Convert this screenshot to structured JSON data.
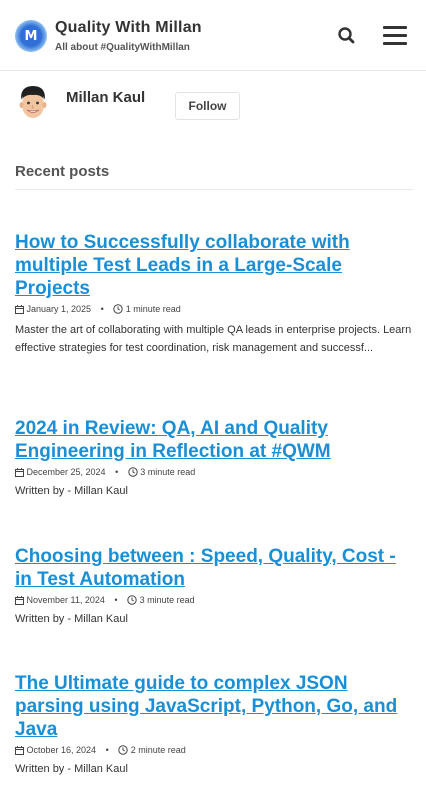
{
  "header": {
    "logo_letter": "M",
    "title": "Quality With Millan",
    "subtitle": "All about #QualityWithMillan"
  },
  "author": {
    "name": "Millan Kaul",
    "follow_label": "Follow"
  },
  "section": {
    "title": "Recent posts"
  },
  "posts": [
    {
      "title": "How to Successfully collaborate with multiple Test Leads in a Large-Scale Projects",
      "date": "January 1, 2025",
      "read_time": "1 minute read",
      "excerpt": "Master the art of collaborating with multiple QA leads in enterprise projects. Learn effective strategies for test coordination, risk management and successf..."
    },
    {
      "title": "2024 in Review: QA, AI and Quality Engineering in Reflection at #QWM",
      "date": "December 25, 2024",
      "read_time": "3 minute read",
      "byline": "Written by - Millan Kaul"
    },
    {
      "title": "Choosing between : Speed, Quality, Cost - in Test Automation",
      "date": "November 11, 2024",
      "read_time": "3 minute read",
      "byline": "Written by - Millan Kaul"
    },
    {
      "title": "The Ultimate guide to complex JSON parsing using JavaScript, Python, Go, and Java",
      "date": "October 16, 2024",
      "read_time": "2 minute read",
      "byline": "Written by - Millan Kaul"
    }
  ],
  "meta_separator": "•",
  "colors": {
    "link": "#1a8fd6",
    "text": "#333333"
  },
  "icons": {
    "search": "search-icon",
    "menu": "hamburger-menu-icon",
    "calendar": "calendar-icon",
    "clock": "clock-icon"
  }
}
